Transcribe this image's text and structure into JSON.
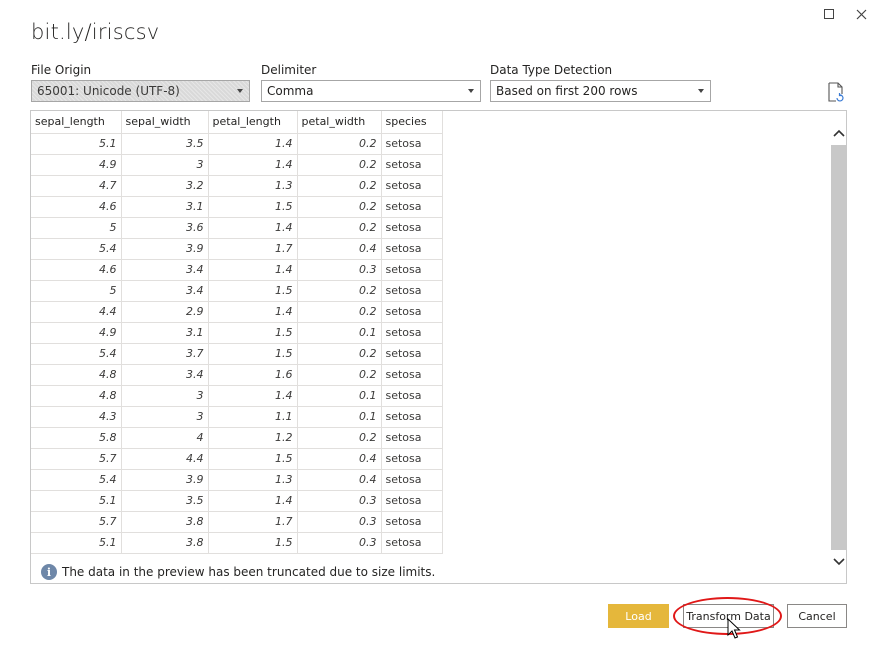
{
  "window": {
    "title": "bit.ly/iriscsv"
  },
  "options": {
    "file_origin": {
      "label": "File Origin",
      "value": "65001: Unicode (UTF-8)"
    },
    "delimiter": {
      "label": "Delimiter",
      "value": "Comma"
    },
    "type_detection": {
      "label": "Data Type Detection",
      "value": "Based on first 200 rows"
    }
  },
  "table": {
    "headers": [
      "sepal_length",
      "sepal_width",
      "petal_length",
      "petal_width",
      "species"
    ],
    "rows": [
      [
        "5.1",
        "3.5",
        "1.4",
        "0.2",
        "setosa"
      ],
      [
        "4.9",
        "3",
        "1.4",
        "0.2",
        "setosa"
      ],
      [
        "4.7",
        "3.2",
        "1.3",
        "0.2",
        "setosa"
      ],
      [
        "4.6",
        "3.1",
        "1.5",
        "0.2",
        "setosa"
      ],
      [
        "5",
        "3.6",
        "1.4",
        "0.2",
        "setosa"
      ],
      [
        "5.4",
        "3.9",
        "1.7",
        "0.4",
        "setosa"
      ],
      [
        "4.6",
        "3.4",
        "1.4",
        "0.3",
        "setosa"
      ],
      [
        "5",
        "3.4",
        "1.5",
        "0.2",
        "setosa"
      ],
      [
        "4.4",
        "2.9",
        "1.4",
        "0.2",
        "setosa"
      ],
      [
        "4.9",
        "3.1",
        "1.5",
        "0.1",
        "setosa"
      ],
      [
        "5.4",
        "3.7",
        "1.5",
        "0.2",
        "setosa"
      ],
      [
        "4.8",
        "3.4",
        "1.6",
        "0.2",
        "setosa"
      ],
      [
        "4.8",
        "3",
        "1.4",
        "0.1",
        "setosa"
      ],
      [
        "4.3",
        "3",
        "1.1",
        "0.1",
        "setosa"
      ],
      [
        "5.8",
        "4",
        "1.2",
        "0.2",
        "setosa"
      ],
      [
        "5.7",
        "4.4",
        "1.5",
        "0.4",
        "setosa"
      ],
      [
        "5.4",
        "3.9",
        "1.3",
        "0.4",
        "setosa"
      ],
      [
        "5.1",
        "3.5",
        "1.4",
        "0.3",
        "setosa"
      ],
      [
        "5.7",
        "3.8",
        "1.7",
        "0.3",
        "setosa"
      ],
      [
        "5.1",
        "3.8",
        "1.5",
        "0.3",
        "setosa"
      ]
    ]
  },
  "notice": {
    "icon": "info-icon",
    "text": "The data in the preview has been truncated due to size limits."
  },
  "buttons": {
    "load": "Load",
    "transform": "Transform Data",
    "cancel": "Cancel"
  },
  "colors": {
    "load_button": "#e5b73b",
    "highlight": "#e01818",
    "info_icon": "#6e87a8"
  }
}
